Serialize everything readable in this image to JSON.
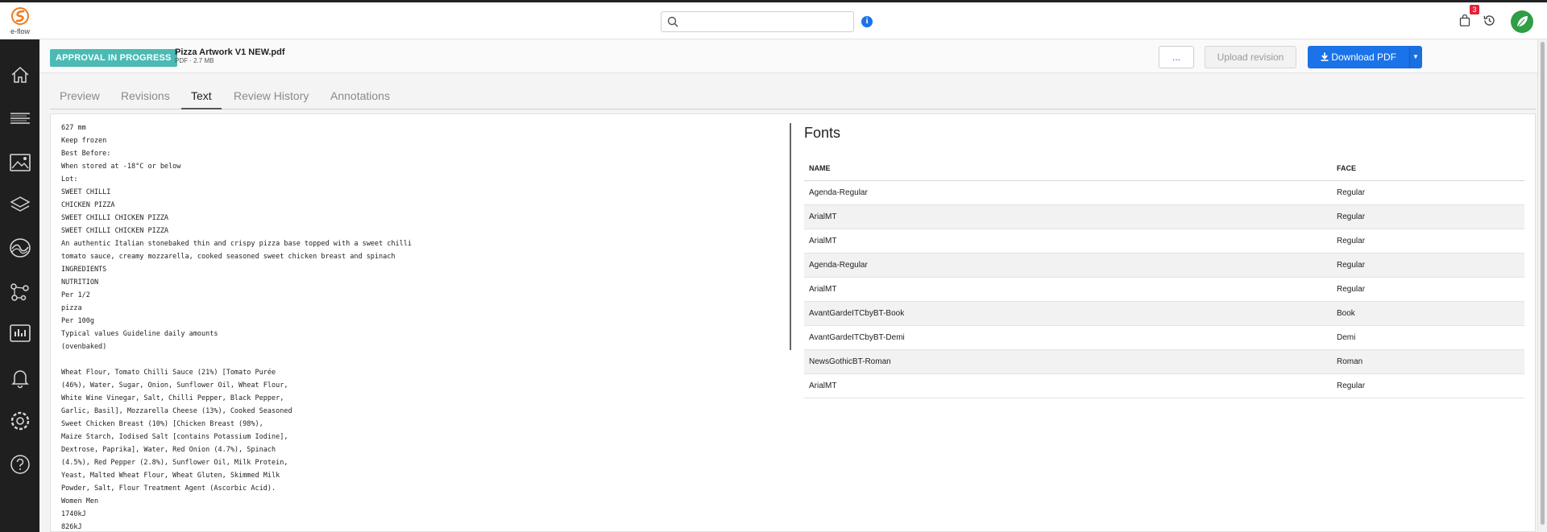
{
  "app": {
    "logo_text": "e-flow"
  },
  "search": {
    "placeholder": "",
    "value": ""
  },
  "notifications": {
    "cart_count": "3"
  },
  "sidebar": {
    "items": [
      {
        "icon": "home-icon",
        "label": "Home"
      },
      {
        "icon": "list-icon",
        "label": "Tasks"
      },
      {
        "icon": "artwork-icon",
        "label": "Artwork"
      },
      {
        "icon": "layers-icon",
        "label": "Layers"
      },
      {
        "icon": "brand-icon",
        "label": "Brand"
      },
      {
        "icon": "workflow-icon",
        "label": "Workflow"
      },
      {
        "icon": "reports-icon",
        "label": "Reports"
      },
      {
        "icon": "bell-icon",
        "label": "Notifications"
      },
      {
        "icon": "settings-icon",
        "label": "Settings"
      },
      {
        "icon": "help-icon",
        "label": "Help"
      }
    ]
  },
  "header": {
    "status": "APPROVAL IN PROGRESS",
    "file_name": "Pizza Artwork V1 NEW.pdf",
    "file_meta": "PDF · 2.7 MB",
    "more_label": "...",
    "upload_label": "Upload revision",
    "download_label": "Download PDF"
  },
  "tabs": [
    "Preview",
    "Revisions",
    "Text",
    "Review History",
    "Annotations"
  ],
  "active_tab": "Text",
  "text_lines": [
    "627 mm",
    "Keep frozen",
    "Best Before:",
    "When stored at -18°C or below",
    "Lot:",
    "SWEET CHILLI",
    "CHICKEN PIZZA",
    "SWEET CHILLI CHICKEN PIZZA",
    "SWEET CHILLI CHICKEN PIZZA",
    "An authentic Italian stonebaked thin and crispy pizza base topped with a sweet chilli",
    "tomato sauce, creamy mozzarella, cooked seasoned sweet chicken breast and spinach",
    "INGREDIENTS",
    "NUTRITION",
    "Per 1/2",
    "pizza",
    "Per 100g",
    "Typical values Guideline daily amounts",
    "(ovenbaked)",
    "",
    "Wheat Flour, Tomato Chilli Sauce (21%) [Tomato Purée",
    "(46%), Water, Sugar, Onion, Sunflower Oil, Wheat Flour,",
    "White Wine Vinegar, Salt, Chilli Pepper, Black Pepper,",
    "Garlic, Basil], Mozzarella Cheese (13%), Cooked Seasoned",
    "Sweet Chicken Breast (10%) [Chicken Breast (98%),",
    "Maize Starch, Iodised Salt [contains Potassium Iodine],",
    "Dextrose, Paprika], Water, Red Onion (4.7%), Spinach",
    "(4.5%), Red Pepper (2.8%), Sunflower Oil, Milk Protein,",
    "Yeast, Malted Wheat Flour, Wheat Gluten, Skimmed Milk",
    "Powder, Salt, Flour Treatment Agent (Ascorbic Acid).",
    "Women Men",
    "1740kJ",
    "826kJ"
  ],
  "fonts": {
    "title": "Fonts",
    "headers": [
      "NAME",
      "FACE"
    ],
    "rows": [
      {
        "name": "Agenda-Regular",
        "face": "Regular"
      },
      {
        "name": "ArialMT",
        "face": "Regular"
      },
      {
        "name": "ArialMT",
        "face": "Regular"
      },
      {
        "name": "Agenda-Regular",
        "face": "Regular"
      },
      {
        "name": "ArialMT",
        "face": "Regular"
      },
      {
        "name": "AvantGardeITCbyBT-Book",
        "face": "Book"
      },
      {
        "name": "AvantGardeITCbyBT-Demi",
        "face": "Demi"
      },
      {
        "name": "NewsGothicBT-Roman",
        "face": "Roman"
      },
      {
        "name": "ArialMT",
        "face": "Regular"
      }
    ]
  },
  "colors": {
    "status_badge": "#4bbab5",
    "primary": "#1a73e8",
    "sidebar": "#1f1f1f",
    "badge": "#e0243a",
    "avatar": "#2f9e44",
    "logo": "#f07a1a"
  }
}
